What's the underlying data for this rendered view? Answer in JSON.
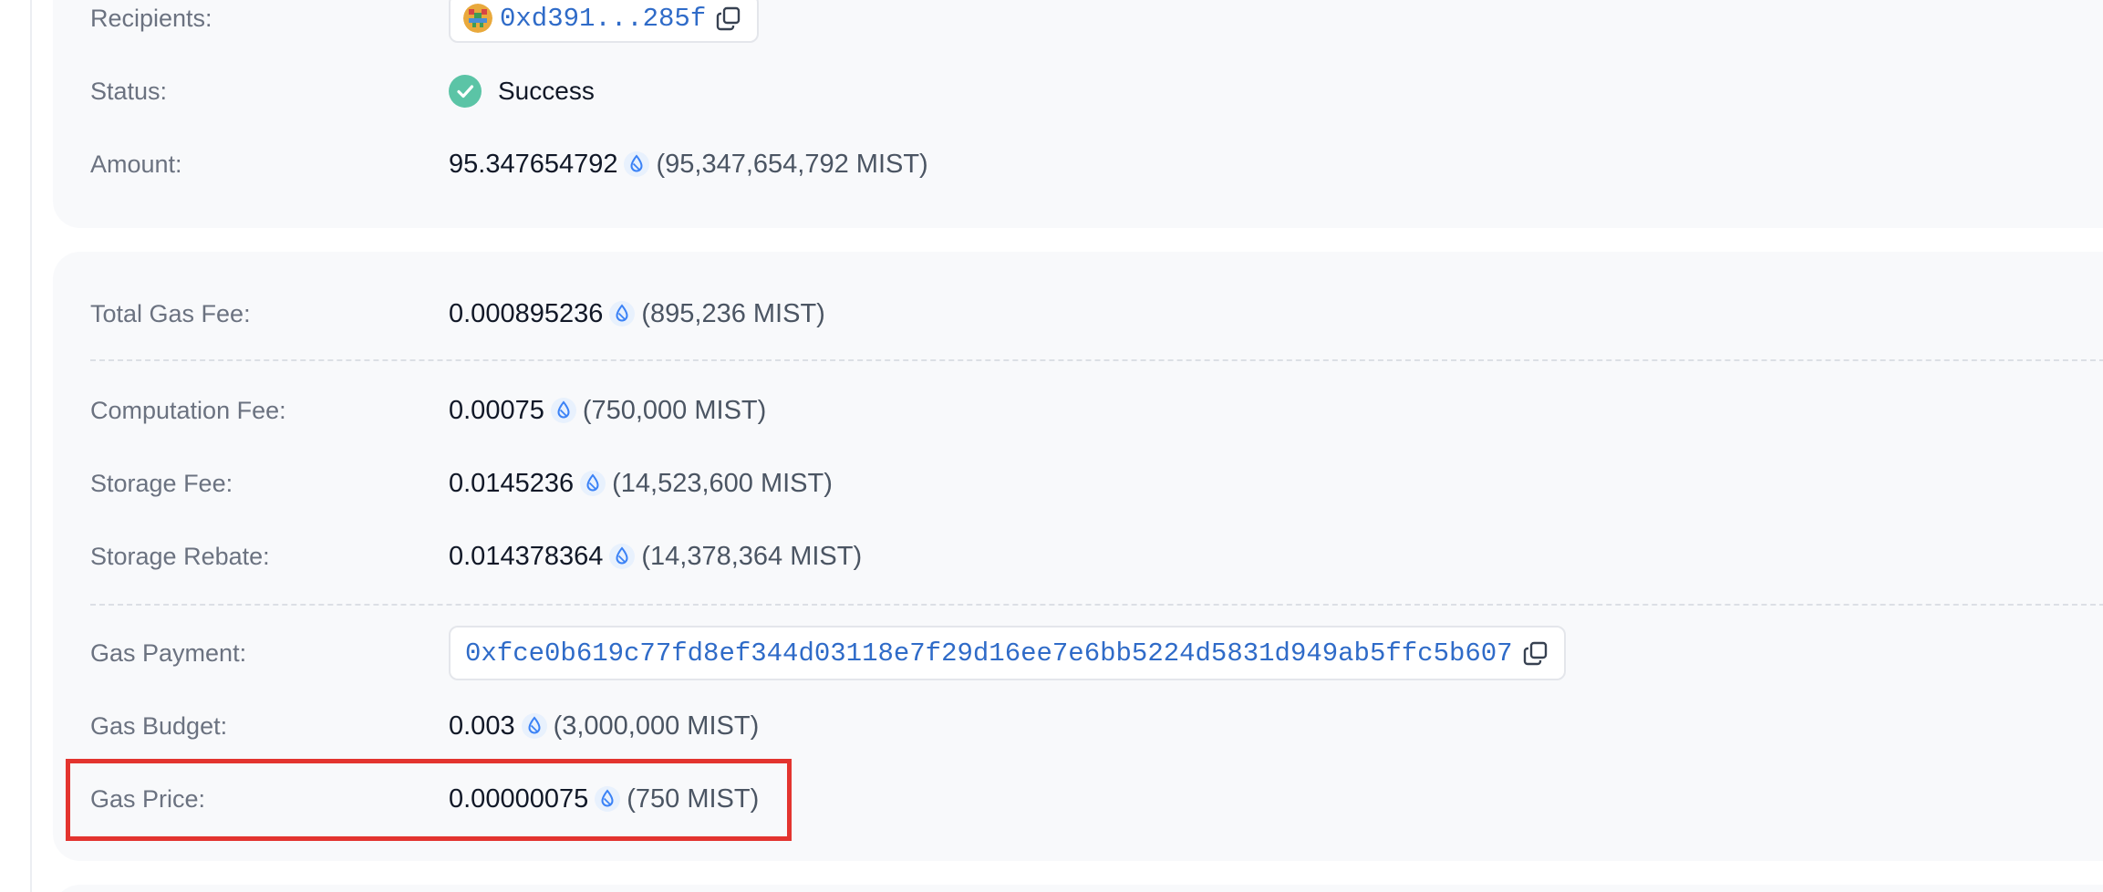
{
  "transfer": {
    "recipients_label": "Recipients:",
    "recipient_address": "0xd391...285f",
    "status_label": "Status:",
    "status_value": "Success",
    "amount_label": "Amount:",
    "amount_value": "95.347654792",
    "amount_mist": "(95,347,654,792 MIST)"
  },
  "gas": {
    "total_fee_label": "Total Gas Fee:",
    "total_fee_value": "0.000895236",
    "total_fee_mist": "(895,236 MIST)",
    "computation_fee_label": "Computation Fee:",
    "computation_fee_value": "0.00075",
    "computation_fee_mist": "(750,000 MIST)",
    "storage_fee_label": "Storage Fee:",
    "storage_fee_value": "0.0145236",
    "storage_fee_mist": "(14,523,600 MIST)",
    "storage_rebate_label": "Storage Rebate:",
    "storage_rebate_value": "0.014378364",
    "storage_rebate_mist": "(14,378,364 MIST)",
    "payment_label": "Gas Payment:",
    "payment_object": "0xfce0b619c77fd8ef344d03118e7f29d16ee7e6bb5224d5831d949ab5ffc5b607",
    "budget_label": "Gas Budget:",
    "budget_value": "0.003",
    "budget_mist": "(3,000,000 MIST)",
    "price_label": "Gas Price:",
    "price_value": "0.00000075",
    "price_mist": "(750 MIST)"
  },
  "icons": {
    "token": "sui-token-icon",
    "copy": "copy-icon",
    "status": "check-circle-icon",
    "avatar": "recipient-avatar"
  },
  "colors": {
    "link": "#2f6bc8",
    "success": "#5bc4a6",
    "highlight": "#e3342f",
    "card_bg": "#f8f9fb"
  }
}
